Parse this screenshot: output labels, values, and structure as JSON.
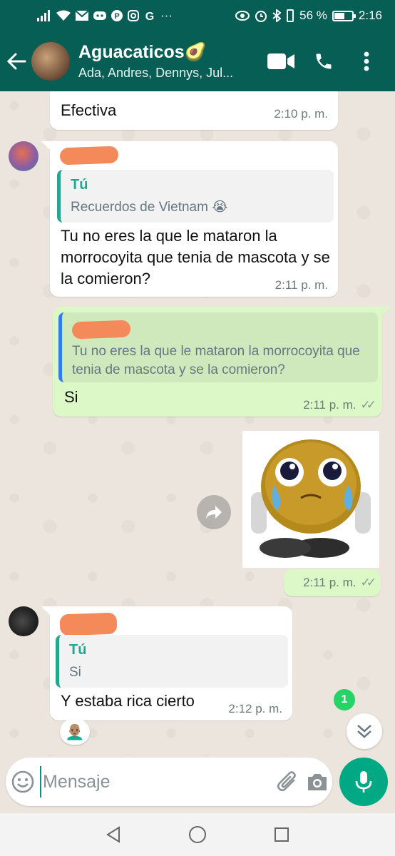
{
  "status_bar": {
    "battery_text": "56 %",
    "battery_level": 0.56,
    "time": "2:16",
    "overflow": "···"
  },
  "header": {
    "title": "Aguacaticos",
    "title_emoji": "🥑",
    "subtitle": "Ada, Andres, Dennys, Jul...",
    "icons": [
      "back-arrow-icon",
      "video-call-icon",
      "voice-call-icon",
      "more-vert-icon"
    ]
  },
  "messages": [
    {
      "direction": "in",
      "text": "Efectiva",
      "time": "2:10 p. m."
    },
    {
      "direction": "in",
      "quote_author": "Tú",
      "quote_text": "Recuerdos de Vietnam 😭",
      "text": "Tu no eres la que le mataron la morrocoyita que tenia de mascota y se la comieron?",
      "time": "2:11 p. m."
    },
    {
      "direction": "out",
      "quote_text": "Tu no eres la que le mataron la morrocoyita que tenia de mascota y se la comieron?",
      "text": "Si",
      "time": "2:11 p. m.",
      "ticks": "✓✓"
    },
    {
      "direction": "out",
      "type": "sticker",
      "time": "2:11 p. m.",
      "ticks": "✓✓"
    },
    {
      "direction": "in",
      "quote_author": "Tú",
      "quote_text": "Si",
      "text": "Y estaba rica cierto",
      "time": "2:12 p. m.",
      "reaction": "👨🏽‍🦲"
    }
  ],
  "unread_count": "1",
  "composer": {
    "placeholder": "Mensaje"
  },
  "colors": {
    "header": "#075e54",
    "outgoing_bubble": "#dcf8c6",
    "accent": "#00a884",
    "quote_author": "#25a68e"
  }
}
